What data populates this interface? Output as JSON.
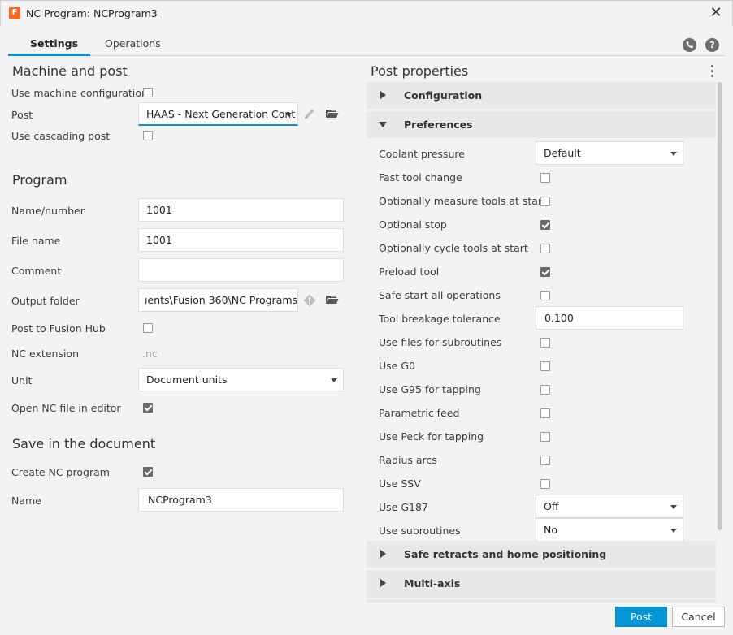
{
  "window": {
    "title": "NC Program: NCProgram3",
    "app_icon_letter": "F"
  },
  "tabs": [
    {
      "label": "Settings"
    },
    {
      "label": "Operations"
    }
  ],
  "header_icons": {
    "phone": "phone-icon",
    "help": "help-icon"
  },
  "machine_post": {
    "title": "Machine and post",
    "use_machine_config_label": "Use machine configuration",
    "use_machine_config_checked": false,
    "post_label": "Post",
    "post_value": "HAAS - Next Generation Cont",
    "use_cascading_label": "Use cascading post",
    "use_cascading_checked": false
  },
  "program": {
    "title": "Program",
    "name_label": "Name/number",
    "name_value": "1001",
    "file_label": "File name",
    "file_value": "1001",
    "comment_label": "Comment",
    "comment_value": "",
    "output_label": "Output folder",
    "output_value": "ıents\\Fusion 360\\NC Programs",
    "post_hub_label": "Post to Fusion Hub",
    "post_hub_checked": false,
    "nc_ext_label": "NC extension",
    "nc_ext_value": ".nc",
    "unit_label": "Unit",
    "unit_value": "Document units",
    "open_editor_label": "Open NC file in editor",
    "open_editor_checked": true
  },
  "save_doc": {
    "title": "Save in the document",
    "create_label": "Create NC program",
    "create_checked": true,
    "name_label": "Name",
    "name_value": "NCProgram3"
  },
  "post_properties": {
    "title": "Post properties",
    "groups": {
      "configuration": "Configuration",
      "preferences": "Preferences",
      "safe_retracts": "Safe retracts and home positioning",
      "multi_axis": "Multi-axis"
    },
    "prefs": [
      {
        "label": "Coolant pressure",
        "type": "select",
        "value": "Default"
      },
      {
        "label": "Fast tool change",
        "type": "checkbox",
        "checked": false
      },
      {
        "label": "Optionally measure tools at start",
        "type": "checkbox",
        "checked": false
      },
      {
        "label": "Optional stop",
        "type": "checkbox",
        "checked": true
      },
      {
        "label": "Optionally cycle tools at start",
        "type": "checkbox",
        "checked": false
      },
      {
        "label": "Preload tool",
        "type": "checkbox",
        "checked": true
      },
      {
        "label": "Safe start all operations",
        "type": "checkbox",
        "checked": false
      },
      {
        "label": "Tool breakage tolerance",
        "type": "input",
        "value": "0.100"
      },
      {
        "label": "Use files for subroutines",
        "type": "checkbox",
        "checked": false
      },
      {
        "label": "Use G0",
        "type": "checkbox",
        "checked": false
      },
      {
        "label": "Use G95 for tapping",
        "type": "checkbox",
        "checked": false
      },
      {
        "label": "Parametric feed",
        "type": "checkbox",
        "checked": false
      },
      {
        "label": "Use Peck for tapping",
        "type": "checkbox",
        "checked": false
      },
      {
        "label": "Radius arcs",
        "type": "checkbox",
        "checked": false
      },
      {
        "label": "Use SSV",
        "type": "checkbox",
        "checked": false
      },
      {
        "label": "Use G187",
        "type": "select",
        "value": "Off"
      },
      {
        "label": "Use subroutines",
        "type": "select",
        "value": "No"
      }
    ]
  },
  "footer": {
    "post_label": "Post",
    "cancel_label": "Cancel"
  },
  "colors": {
    "accent": "#0696d7",
    "background": "#f3f3f3",
    "header_bg": "#e8e8e8"
  }
}
